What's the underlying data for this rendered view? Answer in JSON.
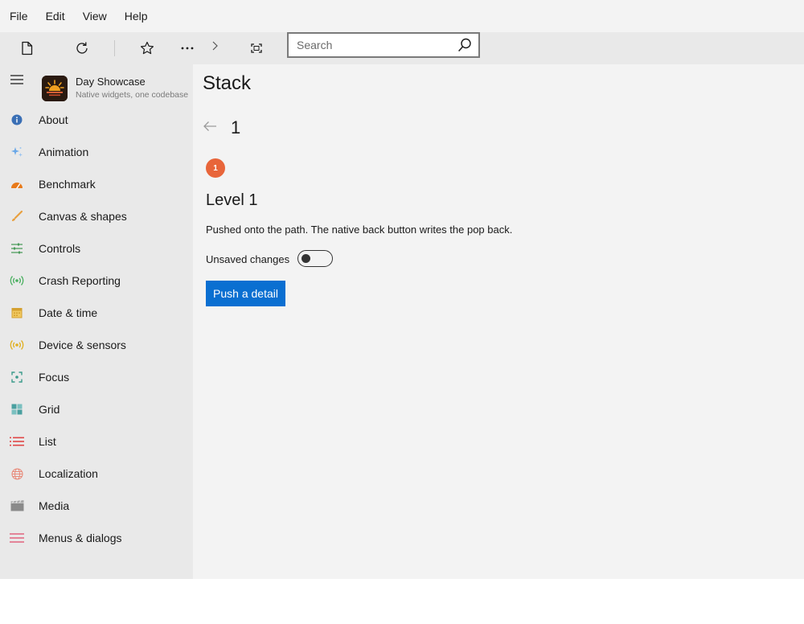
{
  "menubar": {
    "items": [
      "File",
      "Edit",
      "View",
      "Help"
    ]
  },
  "toolbar": {
    "buttons": [
      "new-page-icon",
      "refresh-icon",
      "star-icon",
      "more-icon",
      "chevron-right-icon",
      "fullscreen-icon"
    ],
    "search": {
      "placeholder": "Search",
      "value": ""
    }
  },
  "sidebar": {
    "app_title": "Day Showcase",
    "app_subtitle": "Native widgets, one codebase",
    "items": [
      {
        "label": "About",
        "icon": "info-icon",
        "color": "#3a6fb5"
      },
      {
        "label": "Animation",
        "icon": "sparkle-icon",
        "color": "#6aa8e8"
      },
      {
        "label": "Benchmark",
        "icon": "gauge-icon",
        "color": "#e87a1a"
      },
      {
        "label": "Canvas & shapes",
        "icon": "brush-icon",
        "color": "#e8a040"
      },
      {
        "label": "Controls",
        "icon": "sliders-icon",
        "color": "#4a9a5a"
      },
      {
        "label": "Crash Reporting",
        "icon": "broadcast-icon",
        "color": "#4ab060"
      },
      {
        "label": "Date & time",
        "icon": "calendar-icon",
        "color": "#d4a030"
      },
      {
        "label": "Device & sensors",
        "icon": "sensor-icon",
        "color": "#e0b020"
      },
      {
        "label": "Focus",
        "icon": "focus-icon",
        "color": "#3a9a8a"
      },
      {
        "label": "Grid",
        "icon": "grid-icon",
        "color": "#4aa0a0"
      },
      {
        "label": "List",
        "icon": "list-icon",
        "color": "#e04848"
      },
      {
        "label": "Localization",
        "icon": "globe-icon",
        "color": "#e88a7a"
      },
      {
        "label": "Media",
        "icon": "clapper-icon",
        "color": "#8a8a8a"
      },
      {
        "label": "Menus & dialogs",
        "icon": "menu-lines-icon",
        "color": "#e04868"
      }
    ]
  },
  "main": {
    "page_title": "Stack",
    "level_number": "1",
    "badge": "1",
    "level_title": "Level 1",
    "description": "Pushed onto the path. The native back button writes the pop back.",
    "toggle_label": "Unsaved changes",
    "toggle_on": false,
    "push_button": "Push a detail"
  },
  "colors": {
    "accent": "#0a6fd1",
    "badge": "#e8653a"
  }
}
